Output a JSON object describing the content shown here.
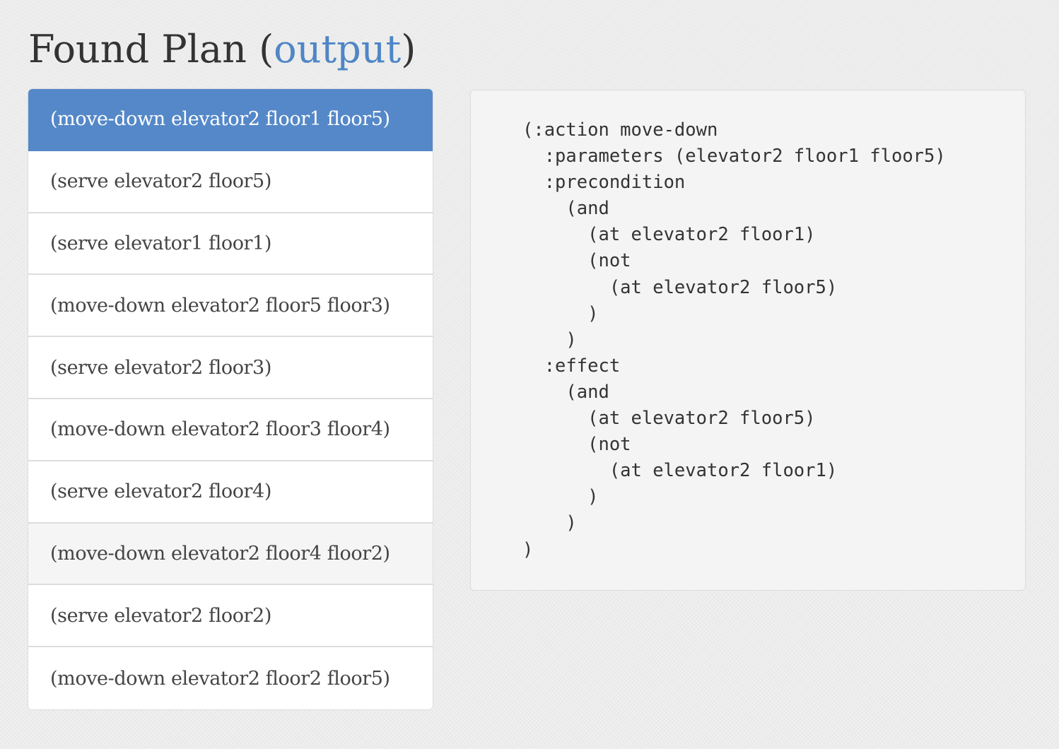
{
  "header": {
    "title": "Found Plan",
    "open_paren": "(",
    "link_label": "output",
    "close_paren": ")"
  },
  "plan": {
    "active_index": 0,
    "hover_index": 7,
    "items": [
      "(move-down elevator2 floor1 floor5)",
      "(serve elevator2 floor5)",
      "(serve elevator1 floor1)",
      "(move-down elevator2 floor5 floor3)",
      "(serve elevator2 floor3)",
      "(move-down elevator2 floor3 floor4)",
      "(serve elevator2 floor4)",
      "(move-down elevator2 floor4 floor2)",
      "(serve elevator2 floor2)",
      "(move-down elevator2 floor2 floor5)"
    ]
  },
  "action_detail": {
    "code": "(:action move-down\n  :parameters (elevator2 floor1 floor5)\n  :precondition\n    (and\n      (at elevator2 floor1)\n      (not\n        (at elevator2 floor5)\n      )\n    )\n  :effect\n    (and\n      (at elevator2 floor5)\n      (not\n        (at elevator2 floor1)\n      )\n    )\n)"
  },
  "colors": {
    "accent": "#5588c8",
    "link": "#4f86c6",
    "text": "#333333",
    "panel_bg": "#f4f4f4"
  }
}
